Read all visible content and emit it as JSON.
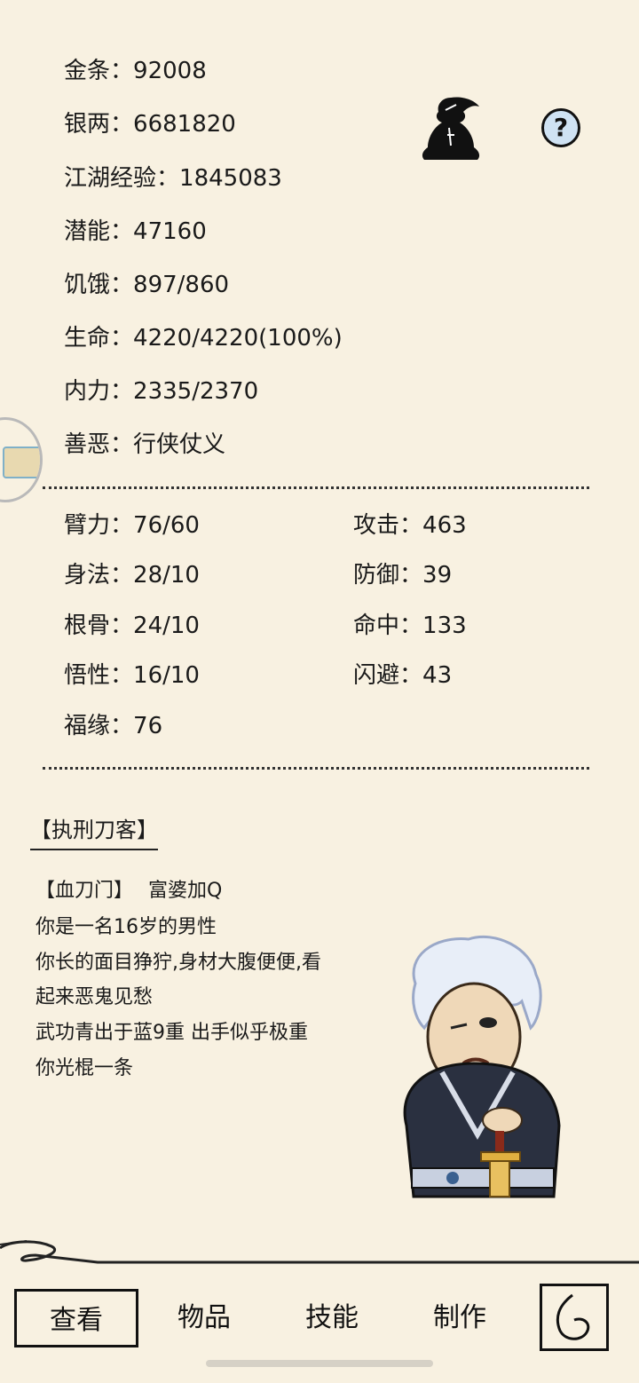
{
  "stats_top": [
    {
      "label": "金条",
      "value": "92008"
    },
    {
      "label": "银两",
      "value": "6681820"
    },
    {
      "label": "江湖经验",
      "value": "1845083"
    },
    {
      "label": "潜能",
      "value": "47160"
    },
    {
      "label": "饥饿",
      "value": "897/860"
    },
    {
      "label": "生命",
      "value": "4220/4220(100%)"
    },
    {
      "label": "内力",
      "value": "2335/2370"
    },
    {
      "label": "善恶",
      "value": "行侠仗义"
    }
  ],
  "stats_left": [
    {
      "label": "臂力",
      "value": "76/60"
    },
    {
      "label": "身法",
      "value": "28/10"
    },
    {
      "label": "根骨",
      "value": "24/10"
    },
    {
      "label": "悟性",
      "value": "16/10"
    },
    {
      "label": "福缘",
      "value": "76"
    }
  ],
  "stats_right": [
    {
      "label": "攻击",
      "value": "463"
    },
    {
      "label": "防御",
      "value": "39"
    },
    {
      "label": "命中",
      "value": "133"
    },
    {
      "label": "闪避",
      "value": "43"
    }
  ],
  "separator": "：",
  "help_symbol": "?",
  "character": {
    "title": "【执刑刀客】",
    "sect": "【血刀门】",
    "name": "富婆加Q",
    "desc_lines": [
      "你是一名16岁的男性",
      "你长的面目狰狞,身材大腹便便,看",
      "起来恶鬼见愁",
      "武功青出于蓝9重 出手似乎极重",
      "你光棍一条"
    ]
  },
  "tabs": [
    {
      "label": "查看",
      "active": true
    },
    {
      "label": "物品",
      "active": false
    },
    {
      "label": "技能",
      "active": false
    },
    {
      "label": "制作",
      "active": false
    }
  ],
  "icons": {
    "meditation": "meditation-icon",
    "help": "help-icon",
    "back": "back-icon",
    "side": "side-float-icon"
  }
}
